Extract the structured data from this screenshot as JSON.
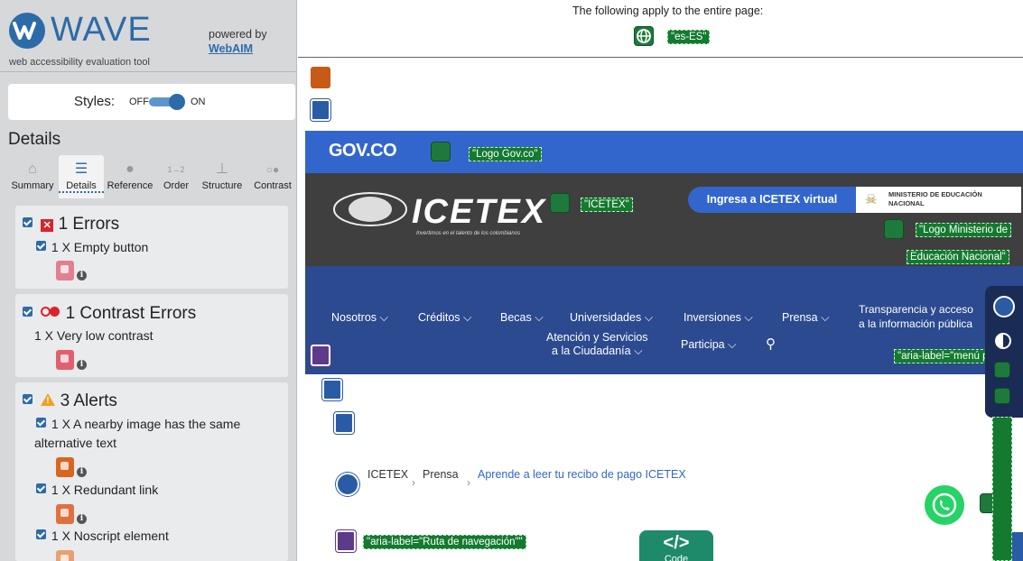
{
  "wave": {
    "title": "WAVE",
    "subtitle": "web accessibility evaluation tool",
    "powered_by": "powered by",
    "webaim": "WebAIM",
    "styles_label": "Styles:",
    "styles_off": "OFF",
    "styles_on": "ON",
    "details_heading": "Details",
    "tabs": [
      {
        "label": "Summary",
        "icon": "home-icon"
      },
      {
        "label": "Details",
        "icon": "list-icon"
      },
      {
        "label": "Reference",
        "icon": "info-icon"
      },
      {
        "label": "Order",
        "icon": "order-icon"
      },
      {
        "label": "Structure",
        "icon": "structure-icon"
      },
      {
        "label": "Contrast",
        "icon": "contrast-icon"
      }
    ],
    "errors": {
      "title": "1 Errors",
      "items": [
        {
          "label": "1 X Empty button"
        }
      ]
    },
    "contrast": {
      "title": "1 Contrast Errors",
      "items": [
        {
          "label": "1 X Very low contrast"
        }
      ]
    },
    "alerts": {
      "title": "3 Alerts",
      "items": [
        {
          "label": "1 X A nearby image has the same",
          "label2": "alternative text"
        },
        {
          "label": "1 X Redundant link"
        },
        {
          "label": "1 X Noscript element"
        }
      ]
    }
  },
  "page": {
    "global_note": "The following apply to the entire page:",
    "lang_tag": "\"es-ES\"",
    "gov_text": "GOV.CO",
    "gov_tag": "\"Logo Gov.co\"",
    "icetex_word": "ICETEX",
    "icetex_sub": "Invertimos en el talento de los colombianos",
    "icetex_tag": "\"ICETEX\"",
    "ingresa": "Ingresa a ICETEX virtual",
    "ministerio_line1": "MINISTERIO DE EDUCACIÓN",
    "ministerio_line2": "NACIONAL",
    "min_tag1": "\"Logo Ministerio de",
    "min_tag2": "Educación Nacional\"",
    "nav": {
      "nosotros": "Nosotros",
      "creditos": "Créditos",
      "becas": "Becas",
      "universidades": "Universidades",
      "inversiones": "Inversiones",
      "prensa": "Prensa",
      "transparencia1": "Transparencia y acceso",
      "transparencia2": "a la información pública",
      "atencion1": "Atención y Servicios",
      "atencion2": "a la Ciudadanía",
      "participa": "Participa",
      "menu_tag": "\"aria-label=\"menú p"
    },
    "breadcrumb": {
      "home": "ICETEX",
      "prensa": "Prensa",
      "current": "Aprende a leer tu recibo de pago ICETEX"
    },
    "ruta_tag": "\"aria-label=\"Ruta de navegación\"\"",
    "code_label": "Code"
  },
  "colors": {
    "wave_blue": "#2c6ba8",
    "gov_blue": "#3366cc",
    "nav_blue": "#2b4a8f",
    "wave_green": "#137a2f",
    "error_red": "#d9232d",
    "alert_orange": "#f0a020"
  }
}
